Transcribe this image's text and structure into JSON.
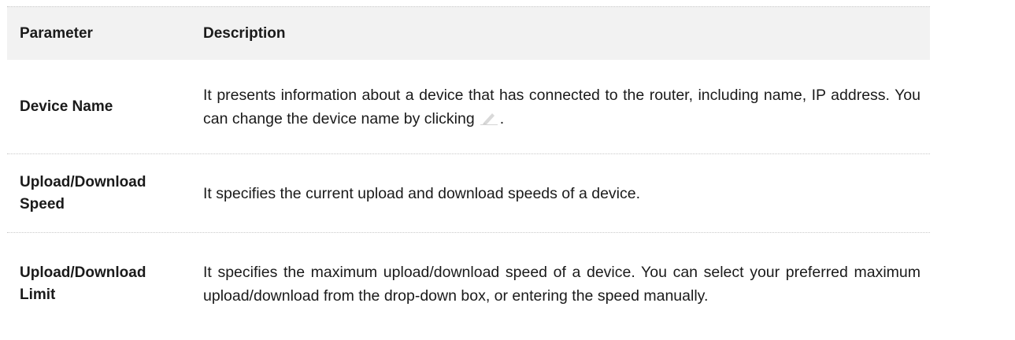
{
  "table": {
    "header": {
      "col1": "Parameter",
      "col2": "Description"
    },
    "rows": [
      {
        "parameter": "Device Name",
        "description_before_icon": "It presents information about a device that has connected to the router, including name, IP address. You can change the device name by clicking",
        "icon": "edit-pencil-icon",
        "description_after_icon": "."
      },
      {
        "parameter_line1": "Upload/Download",
        "parameter_line2": "Speed",
        "description": "It specifies the current upload and download speeds of a device."
      },
      {
        "parameter_line1": "Upload/Download",
        "parameter_line2": "Limit",
        "description": "It specifies the maximum upload/download speed of a device. You can select your preferred maximum upload/download from the drop-down box, or entering the speed manually."
      }
    ]
  }
}
